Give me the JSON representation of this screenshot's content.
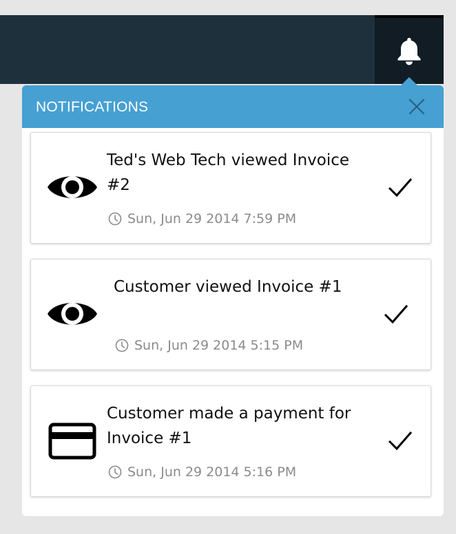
{
  "header": {
    "bell_icon": "bell-icon"
  },
  "panel": {
    "title": "NOTIFICATIONS",
    "close_icon": "close-icon",
    "accent_color": "#46a0d2"
  },
  "notifications": [
    {
      "icon": "eye-icon",
      "message": "Ted's Web Tech viewed Invoice #2",
      "time": "Sun, Jun 29 2014 7:59 PM"
    },
    {
      "icon": "eye-icon",
      "message": "Customer viewed Invoice #1",
      "time": "Sun, Jun 29 2014 5:15 PM"
    },
    {
      "icon": "credit-card-icon",
      "message": "Customer made a payment for Invoice #1",
      "time": "Sun, Jun 29 2014 5:16 PM"
    }
  ]
}
